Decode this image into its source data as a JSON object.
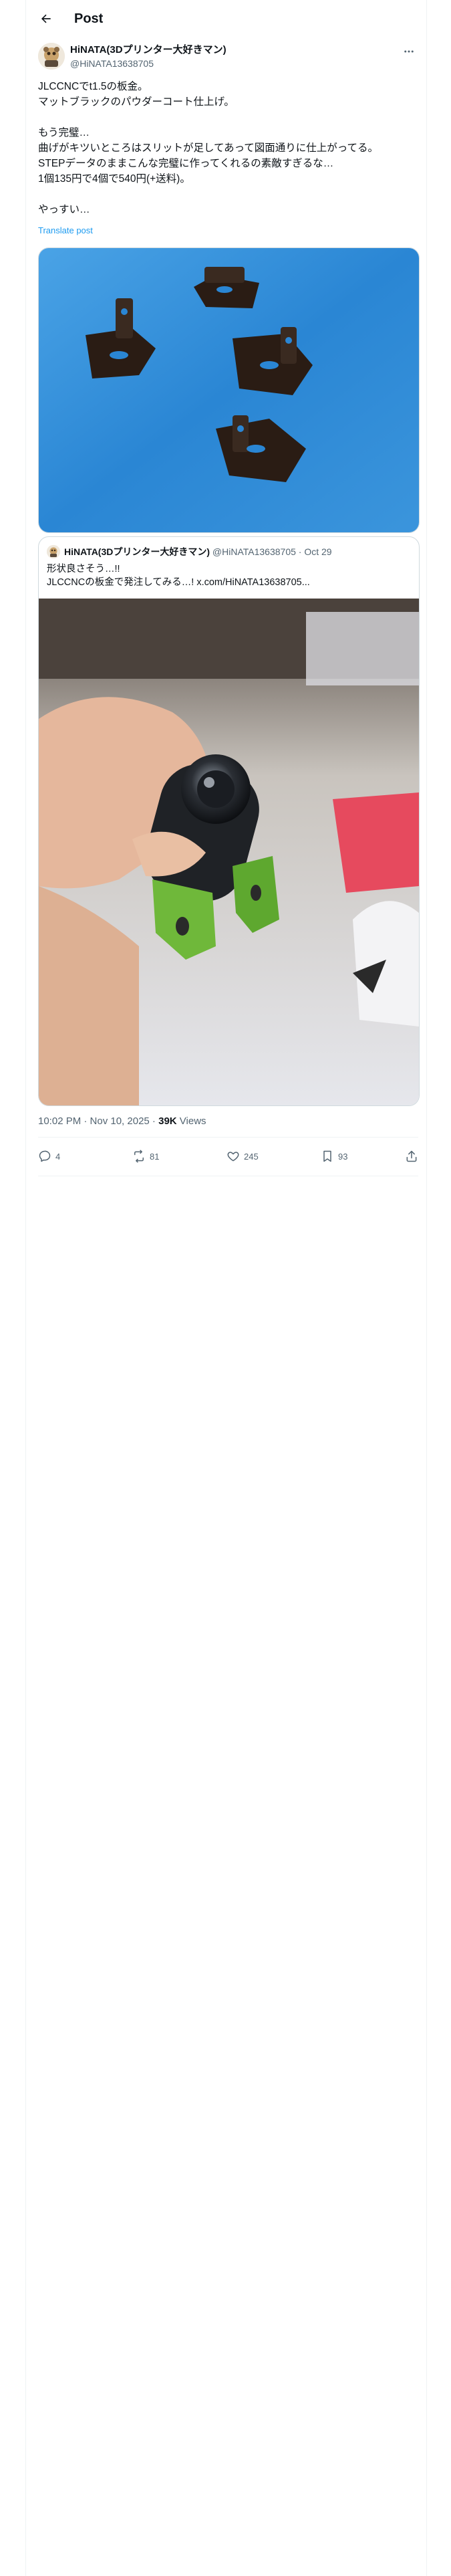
{
  "header": {
    "title": "Post"
  },
  "post": {
    "author_name": "HiNATA(3Dプリンター大好きマン)",
    "author_handle": "@HiNATA13638705",
    "text_lines": [
      "JLCCNCでt1.5の板金。",
      "マットブラックのパウダーコート仕上げ。",
      "",
      "もう完璧…",
      "曲げがキツいところはスリットが足してあって図面通りに仕上がってる。",
      "STEPデータのままこんな完璧に作ってくれるの素敵すぎるな…",
      "1個135円で4個で540円(+送料)。",
      "",
      "やっすい…"
    ],
    "translate_label": "Translate post",
    "timestamp": "10:02 PM · Nov 10, 2025 · ",
    "views_count": "39K",
    "views_label": " Views"
  },
  "quote": {
    "author_name": "HiNATA(3Dプリンター大好きマン)",
    "meta": " @HiNATA13638705 · Oct 29",
    "text_lines": [
      "形状良さそう…!!",
      "JLCCNCの板金で発注してみる…! x.com/HiNATA13638705..."
    ]
  },
  "actions": {
    "reply_count": "4",
    "repost_count": "81",
    "like_count": "245",
    "bookmark_count": "93"
  },
  "colors": {
    "accent": "#1d9bf0",
    "secondary_text": "#536471",
    "border": "#cfd9de"
  },
  "icons": [
    "back-arrow-icon",
    "more-icon",
    "reply-icon",
    "repost-icon",
    "like-icon",
    "bookmark-icon",
    "share-icon"
  ]
}
